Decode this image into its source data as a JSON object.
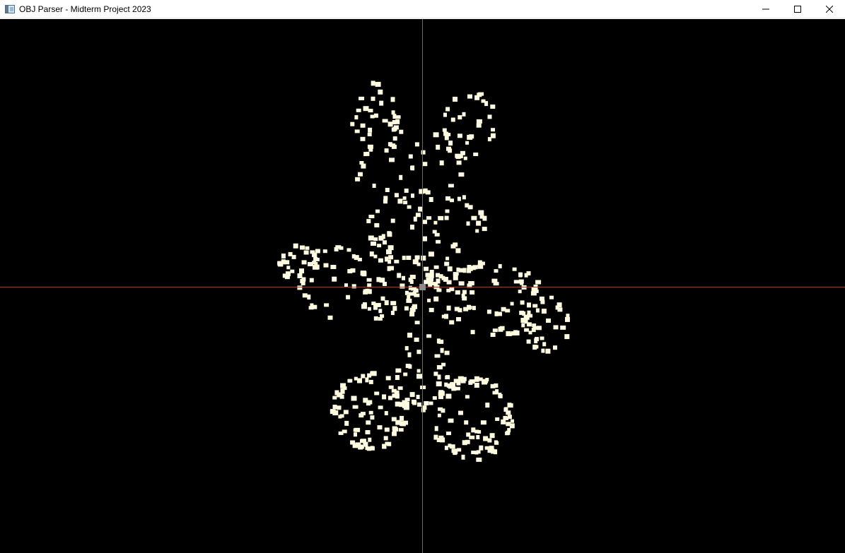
{
  "window": {
    "title": "OBJ Parser - Midterm Project 2023",
    "icon": "app-window-icon",
    "controls": {
      "minimize_icon": "minimize-icon",
      "maximize_icon": "maximize-icon",
      "close_icon": "close-icon"
    }
  },
  "scene": {
    "background_color": "#000000",
    "point_color": "#fffbe1",
    "x_axis_color": "#c0311a",
    "y_axis_color": "#2f8f3a",
    "origin_marker_color": "#8a8a8a",
    "render_mode": "point-cloud"
  }
}
